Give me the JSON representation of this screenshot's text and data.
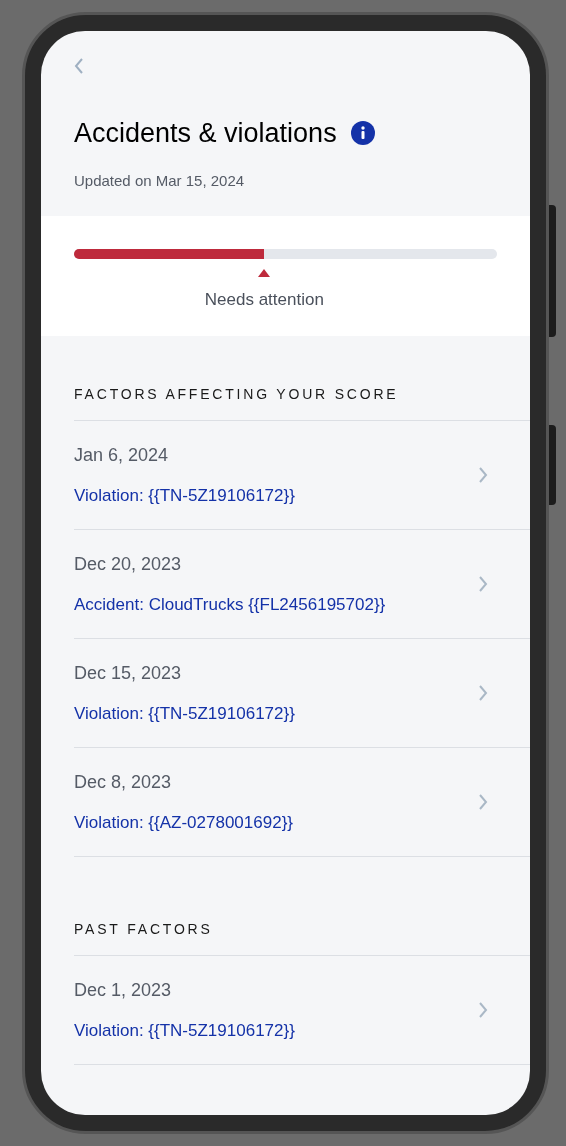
{
  "header": {
    "title": "Accidents & violations",
    "updated": "Updated on Mar 15, 2024"
  },
  "score": {
    "level": 0.45,
    "label": "Needs attention"
  },
  "sections": [
    {
      "heading": "FACTORS AFFECTING YOUR SCORE",
      "items": [
        {
          "date": "Jan 6, 2024",
          "link": "Violation: {{TN-5Z19106172}}"
        },
        {
          "date": "Dec 20, 2023",
          "link": "Accident: CloudTrucks {{FL2456195702}}"
        },
        {
          "date": "Dec 15, 2023",
          "link": "Violation: {{TN-5Z19106172}}"
        },
        {
          "date": "Dec 8, 2023",
          "link": "Violation: {{AZ-0278001692}}"
        }
      ]
    },
    {
      "heading": "PAST FACTORS",
      "items": [
        {
          "date": "Dec 1, 2023",
          "link": "Violation: {{TN-5Z19106172}}"
        }
      ]
    }
  ]
}
